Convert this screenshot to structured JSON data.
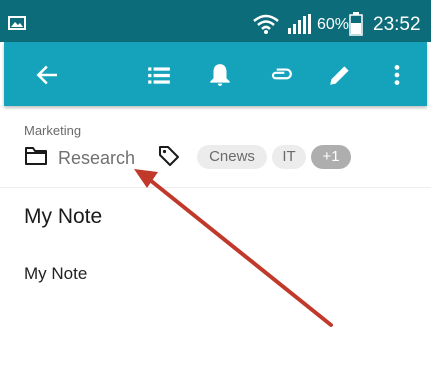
{
  "status_bar": {
    "battery_percent": "60%",
    "time": "23:52",
    "icons": [
      "gallery-icon",
      "wifi-icon",
      "signal-icon",
      "battery-icon"
    ]
  },
  "toolbar": {
    "icons": [
      "back-arrow-icon",
      "list-icon",
      "bell-icon",
      "attachment-icon",
      "edit-icon",
      "more-vert-icon"
    ]
  },
  "note_meta": {
    "notebook": "Marketing",
    "folder": "Research",
    "tags": [
      "Cnews",
      "IT"
    ],
    "more_tags": "+1"
  },
  "note": {
    "title": "My Note",
    "body": "My Note"
  },
  "colors": {
    "status_bar": "#0d6c79",
    "toolbar": "#15a3bb",
    "annotation_arrow": "#c0392b"
  }
}
